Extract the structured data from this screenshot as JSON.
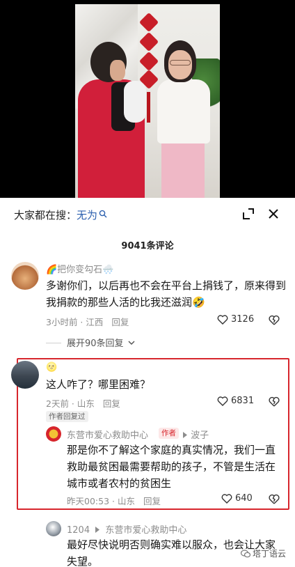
{
  "search": {
    "prefix": "大家都在搜：",
    "keyword": "无为"
  },
  "comments_count": "9041条评论",
  "comments": [
    {
      "user": "🌈把你变勾石🌨️",
      "text": "多谢你们，以后再也不会在平台上捐钱了，原来得到我捐款的那些人活的比我还滋润🤣",
      "time": "3小时前 · 江西",
      "reply": "回复",
      "likes": "3126",
      "expand": "展开90条回复"
    },
    {
      "user": "🌝",
      "text": "这人咋了？哪里困难？",
      "time": "2天前 · 山东",
      "reply": "回复",
      "likes": "6831",
      "author_replied": "作者回复过",
      "sub": {
        "user": "东营市爱心救助中心",
        "author_tag": "作者",
        "reply_to": "波子",
        "text": "那是你不了解这个家庭的真实情况，我们一直救助最贫困最需要帮助的孩子，不管是生活在城市或者农村的贫困生",
        "time": "昨天00:53 · 山东",
        "reply": "回复",
        "likes": "640"
      }
    },
    {
      "user": "1204",
      "reply_to": "东营市爱心救助中心",
      "text": "最好尽快说明否则确实难以服众，也会让大家失望。"
    }
  ],
  "watermark": "塔丁语云",
  "colors": {
    "highlight": "#d7252c",
    "keyword": "#2b5fae",
    "meta": "#8c8c8c"
  }
}
